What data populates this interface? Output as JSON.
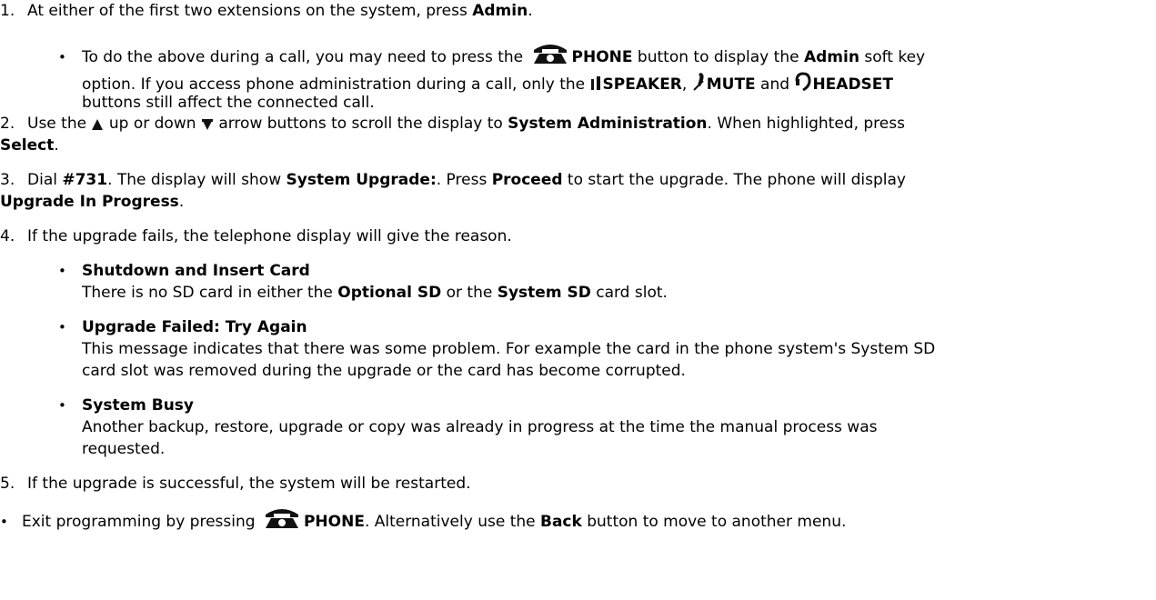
{
  "step1": {
    "num": "1.",
    "text_a": "At either of the first two extensions on the system, press ",
    "admin": "Admin",
    "end": ".",
    "note": {
      "a": "To do the above during a call, you may need to press the ",
      "phone": "PHONE",
      "b": " button to display the ",
      "admin": "Admin",
      "c": " soft key",
      "d": "option. If you access phone administration during a call, only the ",
      "speaker": "SPEAKER",
      "comma": ",",
      "mute": "MUTE",
      "and": " and ",
      "headset": "HEADSET",
      "e": "buttons still affect the connected call."
    }
  },
  "step2": {
    "num": "2.",
    "a": "Use the ",
    "b": " up or down ",
    "c": " arrow buttons to scroll the display to ",
    "sysadmin": "System Administration",
    "d": ". When highlighted, press",
    "select": "Select",
    "end": "."
  },
  "step3": {
    "num": "3.",
    "a": "Dial ",
    "code": "#731",
    "b": ". The display will show ",
    "upgrade": "System Upgrade:",
    "c": ". Press ",
    "proceed": "Proceed",
    "d": " to start the upgrade. The phone will display",
    "progress": "Upgrade In Progress",
    "end": "."
  },
  "step4": {
    "num": "4.",
    "text": "If the upgrade fails, the telephone display will give the reason.",
    "items": [
      {
        "title": "Shutdown and Insert Card",
        "a": "There is no SD card in either the ",
        "optional": "Optional SD",
        "b": " or the ",
        "system": "System SD",
        "c": " card slot."
      },
      {
        "title": "Upgrade Failed: Try Again",
        "line1": "This message indicates that there was some problem. For example the card in the phone system's System SD",
        "line2": "card slot was removed during the upgrade or the card has become corrupted."
      },
      {
        "title": "System Busy",
        "line1": "Another backup, restore, upgrade or copy was already in progress at the time the manual process was",
        "line2": "requested."
      }
    ]
  },
  "step5": {
    "num": "5.",
    "text": "If the upgrade is successful, the system will be restarted."
  },
  "exit": {
    "a": "Exit programming by pressing ",
    "phone": "PHONE",
    "b": ". Alternatively use the ",
    "back": "Back",
    "c": " button to move to another menu."
  },
  "icons": {
    "phone": "phone-icon",
    "speaker": "speaker-icon",
    "mute": "mute-icon",
    "headset": "headset-icon",
    "up": "up-arrow-icon",
    "down": "down-arrow-icon"
  }
}
